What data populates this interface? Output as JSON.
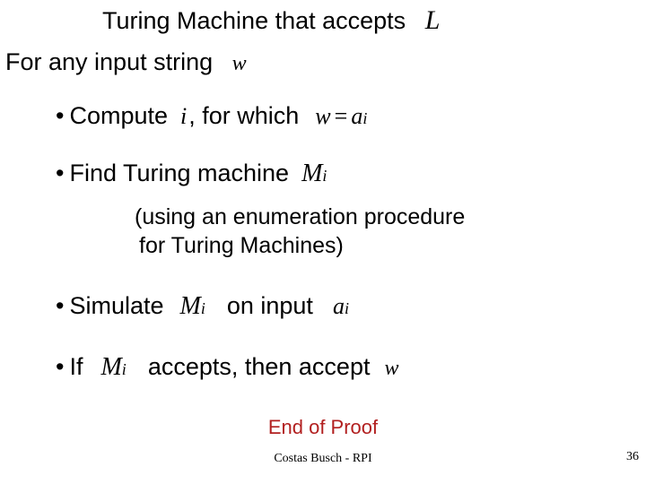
{
  "title": {
    "t1": "Turing Machine that accepts",
    "sym_L": "L"
  },
  "subtitle": {
    "t1": "For any input string",
    "sym_w": "w"
  },
  "bullets": {
    "b1": {
      "dot": "•",
      "t1": "Compute",
      "sym_i": "i",
      "t2": ", for which",
      "eq_lhs": "w",
      "eq_eq": "=",
      "eq_base": "a",
      "eq_sup": "i"
    },
    "b2": {
      "dot": "•",
      "t1": "Find Turing machine",
      "sym_M": "M",
      "sym_M_sub": "i"
    },
    "b2_sub": {
      "t1": "(using an enumeration procedure",
      "t2": " for Turing Machines)"
    },
    "b3": {
      "dot": "•",
      "t1": "Simulate",
      "sym_M": "M",
      "sym_M_sub": "i",
      "t2": "on input",
      "sym_base": "a",
      "sym_sup": "i"
    },
    "b4": {
      "dot": "•",
      "t1": "If",
      "sym_M": "M",
      "sym_M_sub": "i",
      "t2": "accepts, then accept",
      "sym_w": "w"
    }
  },
  "end_proof": "End of Proof",
  "footer": "Costas Busch - RPI",
  "pagenum": "36"
}
